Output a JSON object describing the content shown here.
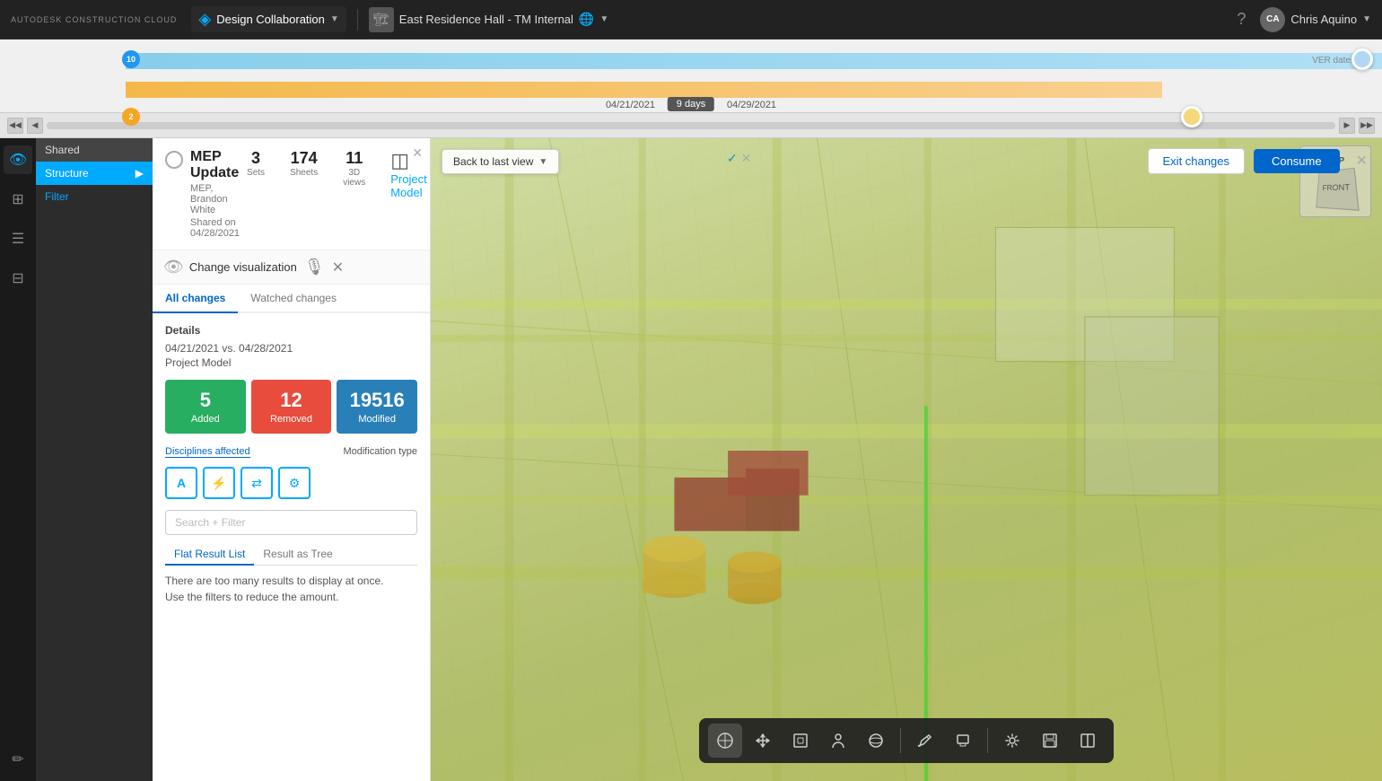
{
  "app": {
    "logo": "AUTODESK CONSTRUCTION CLOUD",
    "app_name": "Design Collaboration",
    "project_name": "East Residence Hall - TM Internal",
    "user_name": "Chris Aquino",
    "user_initials": "CA"
  },
  "sidebar": {
    "shared_label": "Shared",
    "structure_label": "Structure",
    "filter_label": "Filter"
  },
  "timeline": {
    "badge_blue_count": "10",
    "badge_orange_count": "2",
    "days_label": "9 days",
    "date1": "04/21/2021",
    "date2": "04/29/2021"
  },
  "mep_card": {
    "title": "MEP Update",
    "author": "MEP, Brandon White",
    "shared_date": "Shared on 04/28/2021",
    "sets_count": "3",
    "sets_label": "Sets",
    "sheets_count": "174",
    "sheets_label": "Sheets",
    "views_count": "11",
    "views_label": "3D views",
    "model_label": "Project Model"
  },
  "visualization": {
    "title": "Change visualization"
  },
  "tabs": {
    "all_changes": "All changes",
    "watched_changes": "Watched changes"
  },
  "details": {
    "section_title": "Details",
    "date_comparison": "04/21/2021 vs. 04/28/2021",
    "model": "Project Model",
    "added_count": "5",
    "added_label": "Added",
    "removed_count": "12",
    "removed_label": "Removed",
    "modified_count": "19516",
    "modified_label": "Modified"
  },
  "disciplines": {
    "tab1": "Disciplines affected",
    "tab2": "Modification type",
    "icons": [
      "✦",
      "⚡",
      "↔",
      "⚙"
    ]
  },
  "search": {
    "placeholder": "Search + Filter"
  },
  "result_tabs": {
    "flat": "Flat Result List",
    "tree": "Result as Tree"
  },
  "warning": {
    "line1": "There are too many results to display at once.",
    "line2": "Use the filters to reduce the amount."
  },
  "viewport": {
    "back_to_view": "Back to last view",
    "exit_changes": "Exit changes",
    "consume": "Consume",
    "nav_top": "TOP",
    "nav_front": "FRONT"
  },
  "toolbar": {
    "buttons": [
      "⊕",
      "✋",
      "⊞",
      "♟",
      "⊛",
      "✏",
      "◫",
      "⚙",
      "💾",
      "⊡"
    ]
  }
}
